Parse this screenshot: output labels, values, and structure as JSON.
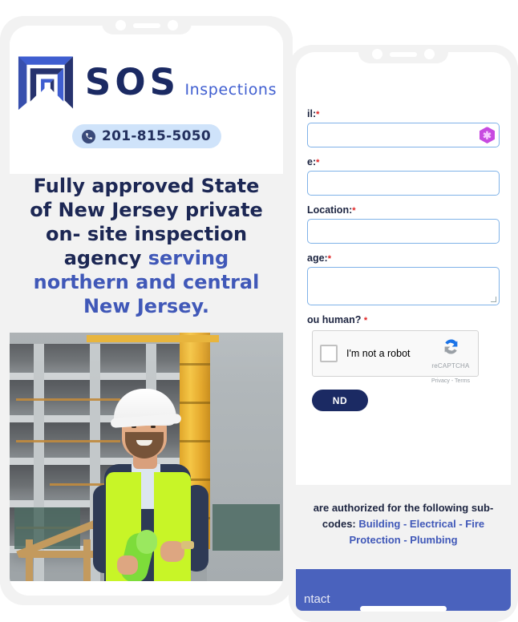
{
  "page": {
    "background": "#ffffff",
    "accent_blue": "#4058b8",
    "navy": "#1b2a63",
    "light_blue_pill": "#cfe3fa"
  },
  "left_phone": {
    "name": "sos-inspections-landing-mockup",
    "logo": {
      "mark_name": "sos-square-spiral-logo",
      "title": "SOS",
      "subtitle": "Inspections"
    },
    "phone_pill": {
      "icon": "phone-icon",
      "number": "201-815-5050"
    },
    "headline": {
      "line1": "Fully approved State of",
      "line2": "New Jersey private on-",
      "line3": "site inspection agency",
      "accent1": "serving northern and",
      "accent2": "central New Jersey."
    },
    "photo": {
      "alt": "Smiling construction inspector in white hard hat and yellow safety vest holding rolled green blueprints in front of a concrete building under construction with a yellow tower crane"
    }
  },
  "right_phone": {
    "name": "contact-form-mockup",
    "form": {
      "fields": [
        {
          "label": "il:",
          "full_label": "Email:",
          "required": true,
          "value": "",
          "placeholder": "",
          "type": "email",
          "badge": "hex-key-icon"
        },
        {
          "label": "e:",
          "full_label": "Phone:",
          "required": true,
          "value": "",
          "placeholder": "",
          "type": "tel"
        },
        {
          "label": "Location:",
          "full_label": "Job Location:",
          "required": true,
          "value": "",
          "placeholder": "",
          "type": "text"
        },
        {
          "label": "age:",
          "full_label": "Message:",
          "required": true,
          "value": "",
          "placeholder": "",
          "type": "textarea"
        }
      ],
      "captcha_label": "ou human?",
      "captcha_required": true,
      "recaptcha": {
        "checkbox_text": "I'm not a robot",
        "brand": "reCAPTCHA",
        "terms": "Privacy - Terms"
      },
      "send_button": "ND",
      "send_button_full": "SEND"
    },
    "subcodes": {
      "line1": "are authorized for the following sub-",
      "prefix2": "codes: ",
      "accent_line2": "Building - Electrical - Fire",
      "accent_line3": "Protection - Plumbing"
    },
    "contact_bar": {
      "label": "ntact",
      "full_label": "Contact",
      "color": "#4a62bd"
    }
  }
}
